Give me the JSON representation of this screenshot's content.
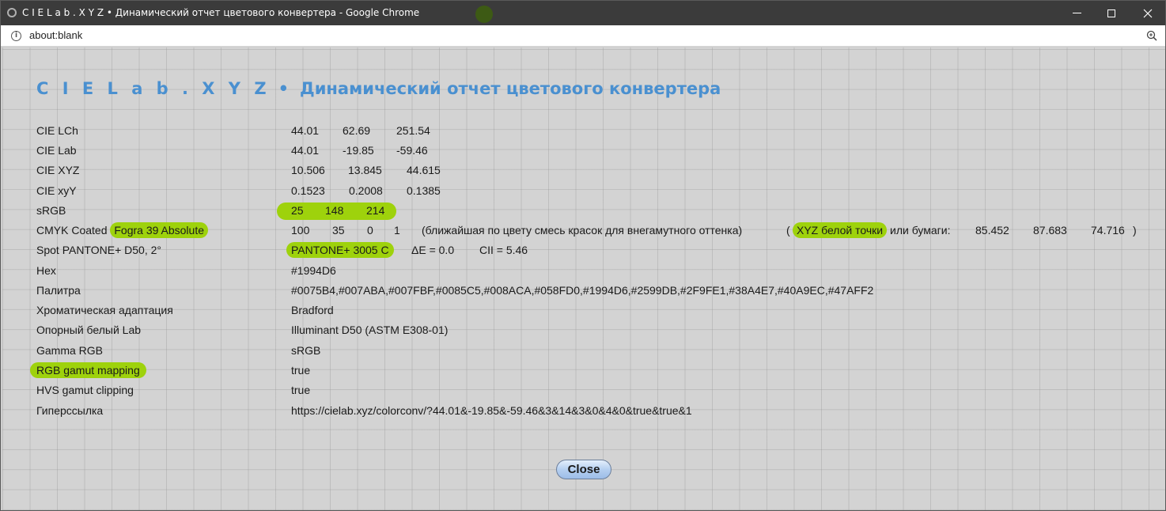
{
  "window": {
    "title": "C I E L a b . X Y Z   •   Динамический отчет цветового конвертера - Google Chrome",
    "url": "about:blank"
  },
  "heading": {
    "brand": "C I E L a b . X Y Z",
    "bullet": "•",
    "subtitle": "Динамический отчет цветового конвертера"
  },
  "rows": {
    "lch": {
      "label": "CIE LCh",
      "v1": "44.01",
      "v2": "62.69",
      "v3": "251.54"
    },
    "lab": {
      "label": "CIE Lab",
      "v1": "44.01",
      "v2": "-19.85",
      "v3": "-59.46"
    },
    "xyz": {
      "label": "CIE XYZ",
      "v1": "10.506",
      "v2": "13.845",
      "v3": "44.615"
    },
    "xyy": {
      "label": "CIE xyY",
      "v1": "0.1523",
      "v2": "0.2008",
      "v3": "0.1385"
    },
    "srgb": {
      "label": "sRGB",
      "v1": "25",
      "v2": "148",
      "v3": "214"
    },
    "cmyk": {
      "label_prefix": "CMYK Coated",
      "label_hl": "Fogra 39 Absolute",
      "c": "100",
      "m": "35",
      "y": "0",
      "k": "1",
      "note": "(ближайшая по цвету смесь красок для внегамутного оттенка)",
      "paren_open": "(",
      "white_hl": "XYZ белой точки",
      "white_rest": "или бумаги:",
      "wx": "85.452",
      "wy": "87.683",
      "wz": "74.716",
      "paren_close": ")"
    },
    "pantone": {
      "label": "Spot PANTONE+ D50, 2°",
      "name": "PANTONE+ 3005 C",
      "de": "ΔE = 0.0",
      "cii": "CII = 5.46"
    },
    "hex": {
      "label": "Hex",
      "value": "#1994D6"
    },
    "palette": {
      "label": "Палитра",
      "value": "#0075B4,#007ABA,#007FBF,#0085C5,#008ACA,#058FD0,#1994D6,#2599DB,#2F9FE1,#38A4E7,#40A9EC,#47AFF2"
    },
    "adapt": {
      "label": "Хроматическая адаптация",
      "value": "Bradford"
    },
    "white": {
      "label": "Опорный белый Lab",
      "value": "Illuminant D50 (ASTM E308-01)"
    },
    "gamma": {
      "label": "Gamma RGB",
      "value": "sRGB"
    },
    "rgbmap": {
      "label": "RGB gamut mapping",
      "value": "true"
    },
    "hvs": {
      "label": "HVS gamut clipping",
      "value": "true"
    },
    "link": {
      "label": "Гиперссылка",
      "value": "https://cielab.xyz/colorconv/?44.01&-19.85&-59.46&3&14&3&0&4&0&true&true&1"
    }
  },
  "close_button": "Close",
  "colors": {
    "heading": "#4a90d0",
    "highlight": "#9ed20c",
    "background": "#d3d3d3"
  }
}
